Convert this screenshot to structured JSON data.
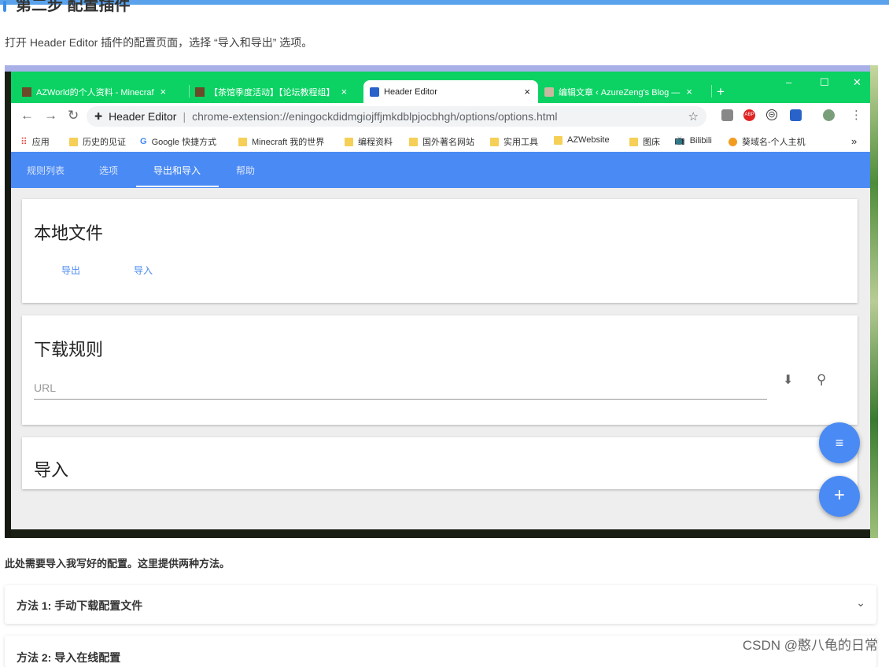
{
  "page": {
    "section_title": "第二步 配置插件",
    "intro": "打开 Header Editor 插件的配置页面，选择 “导入和导出” 选项。",
    "after_text": "此处需要导入我写好的配置。这里提供两种方法。",
    "accordion": [
      {
        "label": "方法 1: 手动下载配置文件"
      },
      {
        "label": "方法 2: 导入在线配置"
      }
    ],
    "watermark": "CSDN @憨八龟的日常"
  },
  "browser": {
    "tabs": [
      {
        "label": "AZWorld的个人资料 - Minecraf",
        "close": "×"
      },
      {
        "label": "【茶馆季度活动】【论坛教程组】",
        "close": "×"
      },
      {
        "label": "Header Editor",
        "close": "×"
      },
      {
        "label": "编辑文章 ‹ AzureZeng's Blog —",
        "close": "×"
      }
    ],
    "new_tab": "+",
    "window_controls": {
      "minimize": "–",
      "maximize": "☐",
      "close": "✕"
    },
    "address": {
      "extension_name": "Header Editor",
      "url": "chrome-extension://eningockdidmgiojffjmkdblpjocbhgh/options/options.html"
    },
    "bookmarks": [
      "应用",
      "历史的见证",
      "Google 快捷方式",
      "Minecraft 我的世界",
      "编程资料",
      "国外著名网站",
      "实用工具",
      "AZWebsite",
      "图床",
      "Bilibili",
      "葵域名-个人主机"
    ],
    "bookmarks_more": "»"
  },
  "app": {
    "nav": [
      "规则列表",
      "选项",
      "导出和导入",
      "帮助"
    ],
    "active_nav": "导出和导入",
    "local_file": {
      "title": "本地文件",
      "export_label": "导出",
      "import_label": "导入"
    },
    "download_rules": {
      "title": "下载规则",
      "url_placeholder": "URL"
    },
    "import_card": {
      "title": "导入"
    }
  },
  "colors": {
    "app_bar": "#4a8af4",
    "tabs_bar": "#0bd263",
    "accent_top": "#5aa3ec"
  }
}
